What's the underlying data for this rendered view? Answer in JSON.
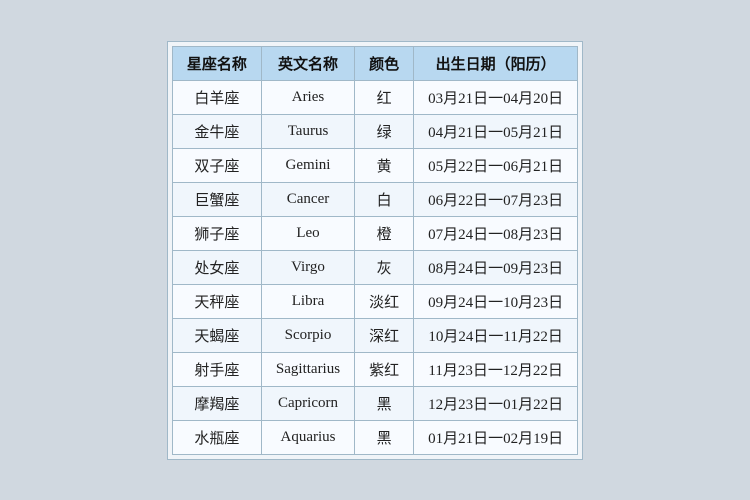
{
  "table": {
    "headers": [
      "星座名称",
      "英文名称",
      "颜色",
      "出生日期（阳历）"
    ],
    "rows": [
      [
        "白羊座",
        "Aries",
        "红",
        "03月21日一04月20日"
      ],
      [
        "金牛座",
        "Taurus",
        "绿",
        "04月21日一05月21日"
      ],
      [
        "双子座",
        "Gemini",
        "黄",
        "05月22日一06月21日"
      ],
      [
        "巨蟹座",
        "Cancer",
        "白",
        "06月22日一07月23日"
      ],
      [
        "狮子座",
        "Leo",
        "橙",
        "07月24日一08月23日"
      ],
      [
        "处女座",
        "Virgo",
        "灰",
        "08月24日一09月23日"
      ],
      [
        "天秤座",
        "Libra",
        "淡红",
        "09月24日一10月23日"
      ],
      [
        "天蝎座",
        "Scorpio",
        "深红",
        "10月24日一11月22日"
      ],
      [
        "射手座",
        "Sagittarius",
        "紫红",
        "11月23日一12月22日"
      ],
      [
        "摩羯座",
        "Capricorn",
        "黑",
        "12月23日一01月22日"
      ],
      [
        "水瓶座",
        "Aquarius",
        "黑",
        "01月21日一02月19日"
      ]
    ]
  }
}
